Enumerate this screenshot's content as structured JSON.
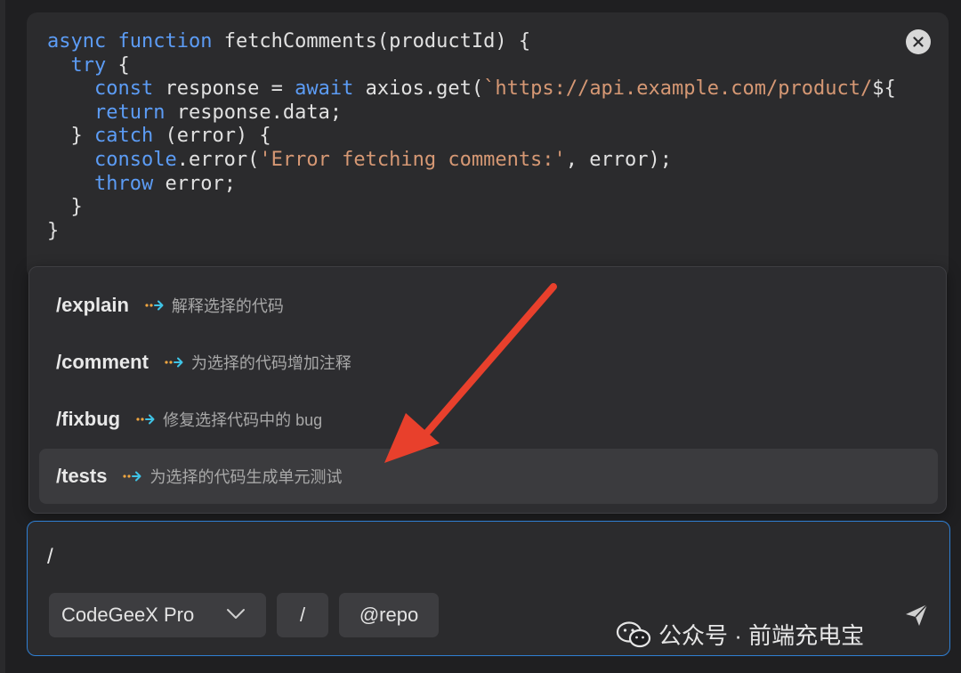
{
  "code": {
    "lines": [
      [
        {
          "t": "kw",
          "v": "async"
        },
        {
          "t": "tx",
          "v": " "
        },
        {
          "t": "kw",
          "v": "function"
        },
        {
          "t": "tx",
          "v": " fetchComments(productId) {"
        }
      ],
      [
        {
          "t": "tx",
          "v": "  "
        },
        {
          "t": "kw",
          "v": "try"
        },
        {
          "t": "tx",
          "v": " {"
        }
      ],
      [
        {
          "t": "tx",
          "v": "    "
        },
        {
          "t": "kw",
          "v": "const"
        },
        {
          "t": "tx",
          "v": " response = "
        },
        {
          "t": "kw",
          "v": "await"
        },
        {
          "t": "tx",
          "v": " axios.get("
        },
        {
          "t": "str",
          "v": "`https://api.example.com/product/"
        },
        {
          "t": "tx",
          "v": "${"
        }
      ],
      [
        {
          "t": "tx",
          "v": "    "
        },
        {
          "t": "kw",
          "v": "return"
        },
        {
          "t": "tx",
          "v": " response.data;"
        }
      ],
      [
        {
          "t": "tx",
          "v": "  } "
        },
        {
          "t": "kw",
          "v": "catch"
        },
        {
          "t": "tx",
          "v": " (error) {"
        }
      ],
      [
        {
          "t": "tx",
          "v": "    "
        },
        {
          "t": "kw",
          "v": "console"
        },
        {
          "t": "tx",
          "v": ".error("
        },
        {
          "t": "str",
          "v": "'Error fetching comments:'"
        },
        {
          "t": "tx",
          "v": ", error);"
        }
      ],
      [
        {
          "t": "tx",
          "v": "    "
        },
        {
          "t": "kw",
          "v": "throw"
        },
        {
          "t": "tx",
          "v": " error;"
        }
      ],
      [
        {
          "t": "tx",
          "v": "  }"
        }
      ],
      [
        {
          "t": "tx",
          "v": "}"
        }
      ]
    ]
  },
  "close_icon": "close-icon",
  "menu": {
    "items": [
      {
        "name": "/explain",
        "desc": "解释选择的代码",
        "active": false
      },
      {
        "name": "/comment",
        "desc": "为选择的代码增加注释",
        "active": false
      },
      {
        "name": "/fixbug",
        "desc": "修复选择代码中的 bug",
        "active": false
      },
      {
        "name": "/tests",
        "desc": "为选择的代码生成单元测试",
        "active": true
      }
    ]
  },
  "input": {
    "value": "/",
    "model_label": "CodeGeeX Pro",
    "slash_label": "/",
    "repo_label": "@repo"
  },
  "watermark": {
    "text": "公众号 · 前端充电宝"
  },
  "colors": {
    "accent": "#2f7fd3",
    "annotation_arrow": "#e8402c",
    "keyword": "#5c9cf5",
    "string": "#d69874"
  }
}
